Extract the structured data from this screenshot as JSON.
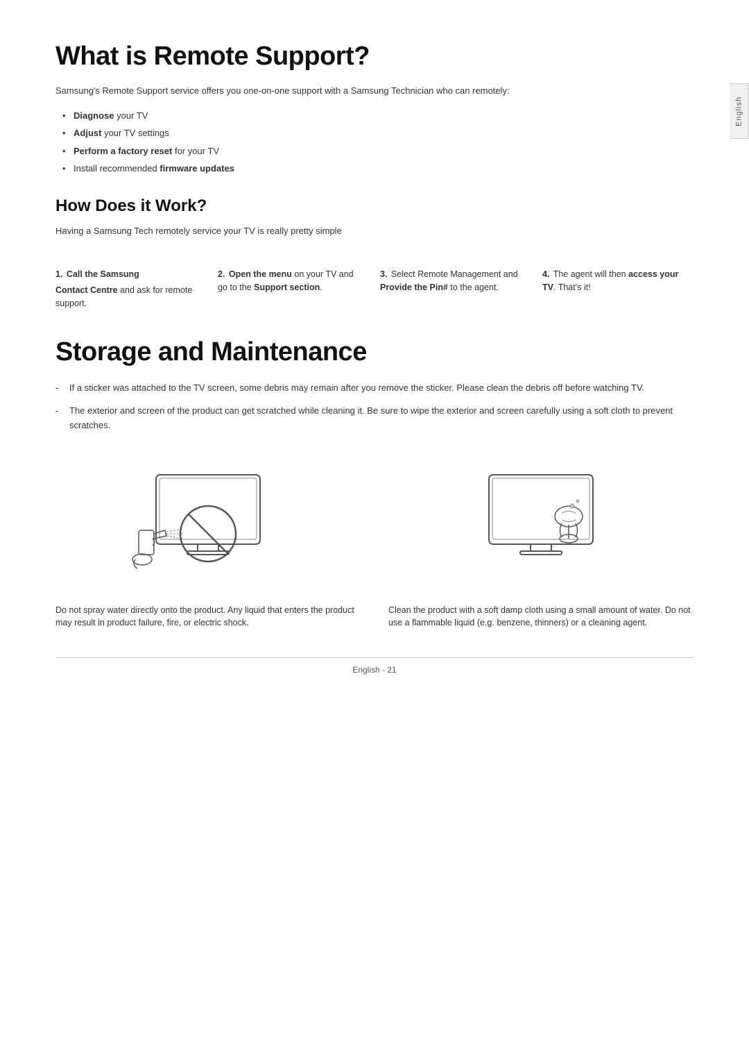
{
  "page": {
    "side_tab": "English",
    "section1": {
      "title": "What is Remote Support?",
      "intro": "Samsung's Remote Support service offers you one-on-one support with a Samsung Technician who can remotely:",
      "bullets": [
        {
          "bold": "Diagnose",
          "rest": " your TV"
        },
        {
          "bold": "Adjust",
          "rest": " your TV settings"
        },
        {
          "bold": "Perform a factory reset",
          "rest": " for your TV"
        },
        {
          "normal": "Install recommended ",
          "bold": "firmware updates",
          "rest": ""
        }
      ],
      "subsection": {
        "title": "How Does it Work?",
        "intro": "Having a Samsung Tech remotely service your TV is really pretty simple",
        "steps": [
          {
            "number": "1.",
            "heading_bold": "Call the Samsung",
            "text": "Contact Centre and ask for remote support."
          },
          {
            "number": "2.",
            "heading_pre": "Open the menu",
            "heading_normal": " on your TV and go to the ",
            "heading_bold": "Support section",
            "heading_end": "."
          },
          {
            "number": "3.",
            "text_pre": "Select Remote Management and ",
            "text_bold": "Provide the Pin#",
            "text_post": " to the agent."
          },
          {
            "number": "4.",
            "text_pre": "The agent will then ",
            "text_bold": "access your TV",
            "text_post": ". That's it!"
          }
        ]
      }
    },
    "section2": {
      "title": "Storage and Maintenance",
      "bullets": [
        "If a sticker was attached to the TV screen, some debris may remain after you remove the sticker. Please clean the debris off before watching TV.",
        "The exterior and screen of the product can get scratched while cleaning it. Be sure to wipe the exterior and screen carefully using a soft cloth to prevent scratches."
      ],
      "images": [
        {
          "caption": "Do not spray water directly onto the product. Any liquid that enters the product may result in product failure, fire, or electric shock."
        },
        {
          "caption": "Clean the product with a soft damp cloth using a small amount of water. Do not use a flammable liquid (e.g. benzene, thinners) or a cleaning agent."
        }
      ]
    },
    "footer": {
      "text": "English - 21"
    }
  }
}
